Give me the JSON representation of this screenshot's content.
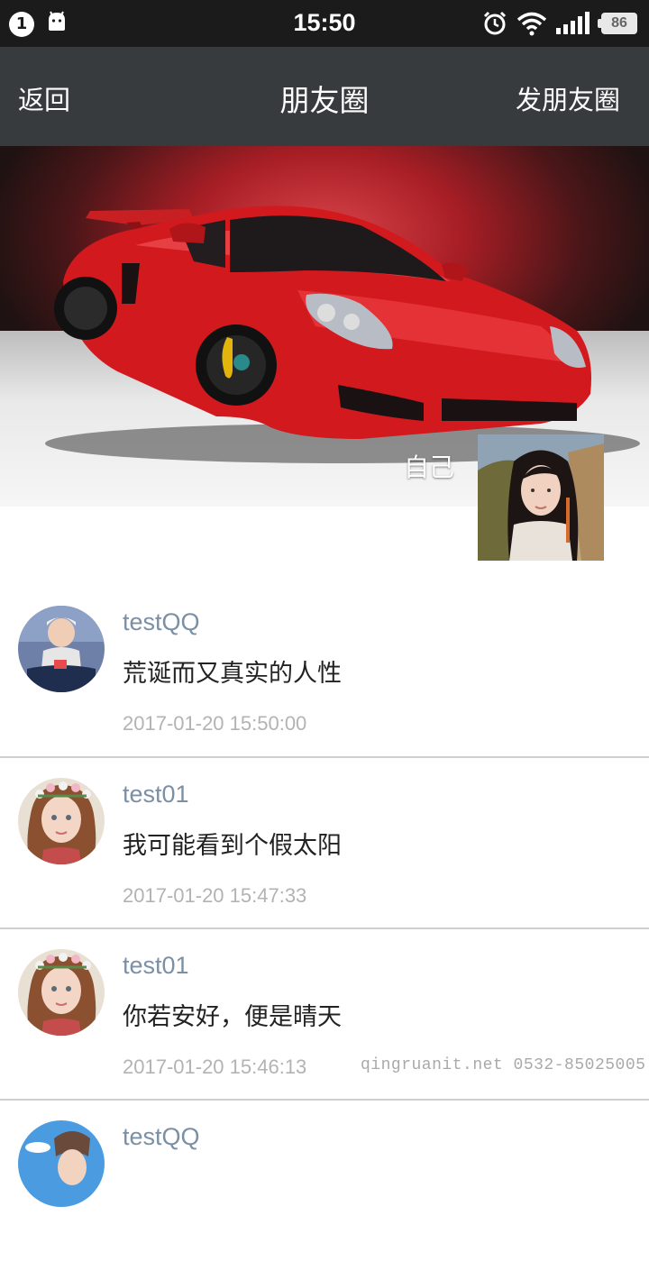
{
  "status_bar": {
    "notification_count": "1",
    "time": "15:50",
    "battery": "86",
    "icons": [
      "notification-badge-icon",
      "android-icon",
      "alarm-icon",
      "wifi-icon",
      "signal-icon",
      "battery-icon"
    ]
  },
  "title_bar": {
    "back_label": "返回",
    "title": "朋友圈",
    "post_label": "发朋友圈"
  },
  "cover": {
    "user_name": "自己"
  },
  "posts": [
    {
      "name": "testQQ",
      "content": "荒诞而又真实的人性",
      "time": "2017-01-20 15:50:00"
    },
    {
      "name": "test01",
      "content": "我可能看到个假太阳",
      "time": "2017-01-20 15:47:33"
    },
    {
      "name": "test01",
      "content": "你若安好，便是晴天",
      "time": "2017-01-20 15:46:13"
    },
    {
      "name": "testQQ",
      "content": "",
      "time": ""
    }
  ],
  "watermark": "qingruanit.net 0532-85025005",
  "colors": {
    "status_bar": "#1b1b1b",
    "title_bar": "#383b3d",
    "username": "#7b8fa5",
    "timestamp": "#b3b3b3",
    "divider": "#cfcfcf"
  }
}
